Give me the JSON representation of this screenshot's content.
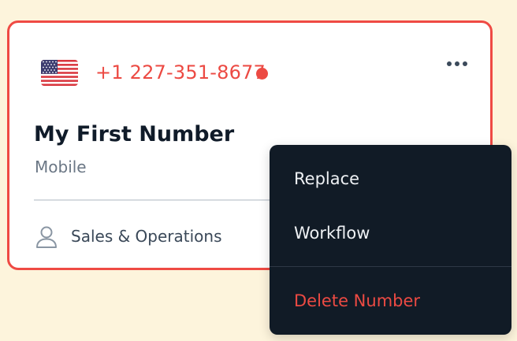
{
  "card": {
    "flag_icon": "us-flag-icon",
    "phone_number": "+1 227-351-8677",
    "status_color": "#ec4a43",
    "title": "My First Number",
    "type": "Mobile",
    "team_icon": "user-icon",
    "team": "Sales & Operations",
    "more_icon": "more-horizontal-icon",
    "border_color": "#ef4a44"
  },
  "menu": {
    "items": [
      {
        "label": "Replace"
      },
      {
        "label": "Workflow"
      },
      {
        "label": "Delete Number"
      }
    ],
    "danger_color": "#ec4a43",
    "background": "#111b26"
  }
}
